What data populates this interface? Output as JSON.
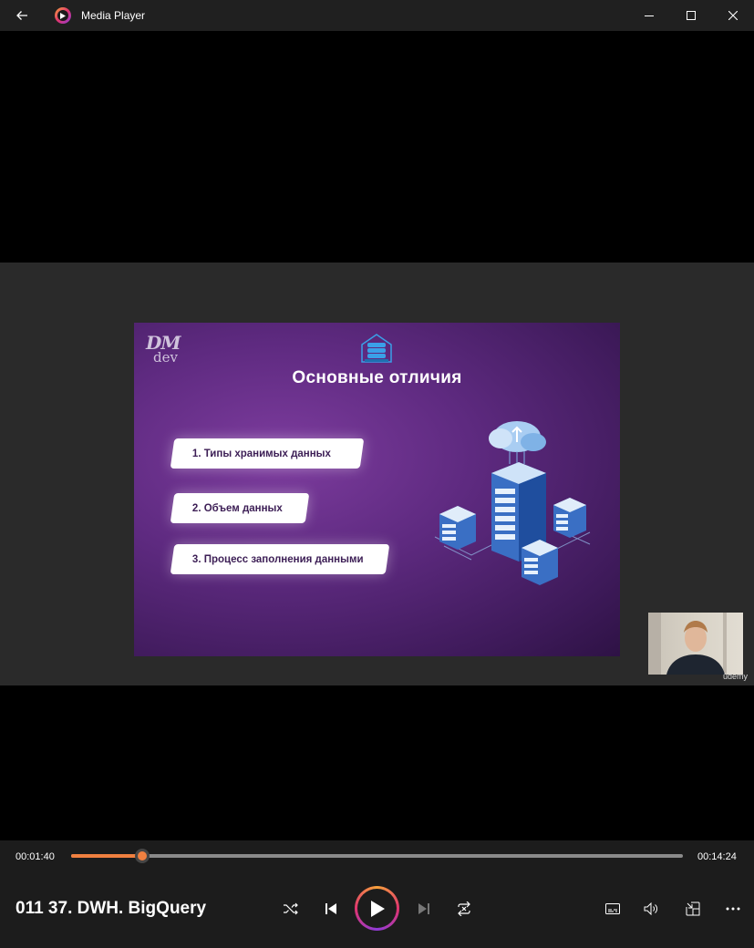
{
  "window": {
    "title": "Media Player"
  },
  "slide": {
    "logo_dm": "DM",
    "logo_dev": "dev",
    "title": "Основные отличия",
    "items": [
      "1. Типы хранимых данных",
      "2. Объем данных",
      "3. Процесс заполнения данными"
    ]
  },
  "webcam": {
    "watermark": "ûdemy"
  },
  "player": {
    "current_time": "00:01:40",
    "total_time": "00:14:24",
    "progress": 0.116,
    "track_title": "011 37. DWH. BigQuery"
  },
  "icons": {
    "back": "back-arrow-icon",
    "app": "media-player-logo-icon",
    "shuffle": "shuffle-icon",
    "previous": "previous-track-icon",
    "play": "play-icon",
    "next": "next-track-icon",
    "repeat": "repeat-icon",
    "subtitles": "subtitles-icon",
    "volume": "volume-icon",
    "miniplayer": "miniplayer-icon",
    "more": "more-icon"
  },
  "colors": {
    "accent": "#f08040",
    "titlebar": "#202020",
    "controls_bg": "#1c1c1c",
    "slide_purple": "#5e2a80"
  }
}
